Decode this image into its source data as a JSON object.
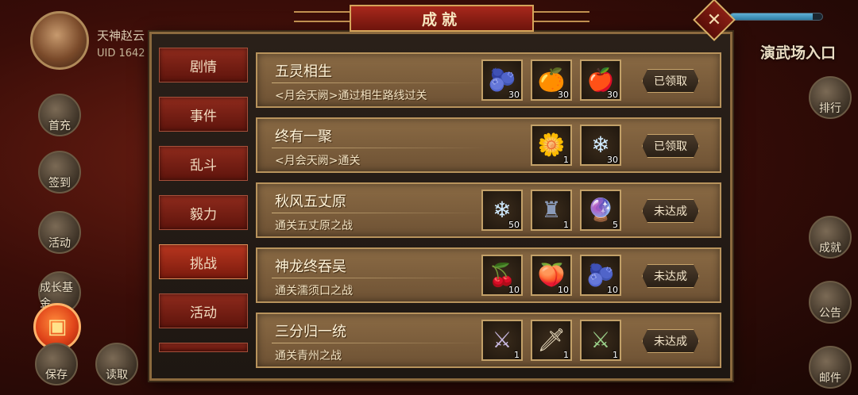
{
  "player": {
    "name": "天神赵云",
    "uid_label": "UID 1642"
  },
  "hud": {
    "entrance_label": "演武场入口",
    "hp_level": 0.9,
    "left_buttons": [
      {
        "label": "首充",
        "icon": "first-charge-icon"
      },
      {
        "label": "签到",
        "icon": "sign-in-icon"
      },
      {
        "label": "活动",
        "icon": "event-icon"
      },
      {
        "label": "成长基金",
        "icon": "growth-fund-icon"
      },
      {
        "label": "保存",
        "icon": "save-icon"
      },
      {
        "label": "读取",
        "icon": "load-icon"
      }
    ],
    "right_buttons": [
      {
        "label": "排行",
        "icon": "ranking-icon"
      },
      {
        "label": "成就",
        "icon": "achievement-icon"
      },
      {
        "label": "公告",
        "icon": "announcement-icon"
      },
      {
        "label": "邮件",
        "icon": "mail-icon"
      }
    ]
  },
  "panel": {
    "title": "成就",
    "close_icon": "close-icon"
  },
  "tabs": [
    {
      "label": "剧情"
    },
    {
      "label": "事件"
    },
    {
      "label": "乱斗"
    },
    {
      "label": "毅力"
    },
    {
      "label": "挑战"
    },
    {
      "label": "活动"
    }
  ],
  "achievements": [
    {
      "title": "五灵相生",
      "desc": "<月会天阙>通过相生路线过关",
      "status": "已领取",
      "rewards": [
        {
          "icon": "blue-fruit-icon",
          "glyph": "🫐",
          "count": "30"
        },
        {
          "icon": "orange-fruit-icon",
          "glyph": "🍊",
          "count": "30"
        },
        {
          "icon": "red-fruit-icon",
          "glyph": "🍎",
          "count": "30"
        }
      ]
    },
    {
      "title": "终有一聚",
      "desc": "<月会天阙>通关",
      "status": "已领取",
      "rewards": [
        {
          "icon": "golden-flower-icon",
          "glyph": "🌼",
          "count": "1"
        },
        {
          "icon": "ice-crystal-icon",
          "glyph": "❄",
          "count": "30"
        }
      ]
    },
    {
      "title": "秋风五丈原",
      "desc": "通关五丈原之战",
      "status": "未达成",
      "rewards": [
        {
          "icon": "ice-crystal-icon",
          "glyph": "❄",
          "count": "50"
        },
        {
          "icon": "dark-statue-icon",
          "glyph": "♜",
          "count": "1"
        },
        {
          "icon": "rainbow-orb-icon",
          "glyph": "🔮",
          "count": "5"
        }
      ]
    },
    {
      "title": "神龙终吞吴",
      "desc": "通关濡须口之战",
      "status": "未达成",
      "rewards": [
        {
          "icon": "red-berries-icon",
          "glyph": "🍒",
          "count": "10"
        },
        {
          "icon": "orange-berries-icon",
          "glyph": "🍑",
          "count": "10"
        },
        {
          "icon": "blue-berries-icon",
          "glyph": "🫐",
          "count": "10"
        }
      ]
    },
    {
      "title": "三分归一统",
      "desc": "通关青州之战",
      "status": "未达成",
      "rewards": [
        {
          "icon": "spear-icon",
          "glyph": "⚔",
          "count": "1"
        },
        {
          "icon": "flame-blade-icon",
          "glyph": "🗡",
          "count": "1"
        },
        {
          "icon": "green-sword-icon",
          "glyph": "⚔",
          "count": "1"
        }
      ]
    }
  ]
}
